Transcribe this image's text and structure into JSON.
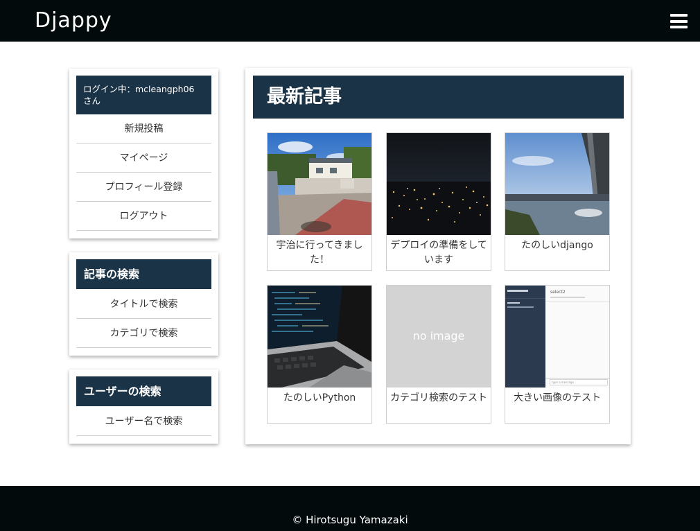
{
  "header": {
    "brand": "Djappy",
    "menu_icon": "hamburger-menu-icon"
  },
  "sidebar": {
    "login_status": "ログイン中：mcleangph06 さん",
    "user_menu": [
      {
        "label": "新規投稿"
      },
      {
        "label": "マイページ"
      },
      {
        "label": "プロフィール登録"
      },
      {
        "label": "ログアウト"
      }
    ],
    "article_search": {
      "heading": "記事の検索",
      "items": [
        {
          "label": "タイトルで検索"
        },
        {
          "label": "カテゴリで検索"
        }
      ]
    },
    "user_search": {
      "heading": "ユーザーの検索",
      "items": [
        {
          "label": "ユーザー名で検索"
        }
      ]
    }
  },
  "main": {
    "heading": "最新記事",
    "articles": [
      {
        "title": "宇治に行ってきました！",
        "image": "photo-street-building"
      },
      {
        "title": "デプロイの準備をしています",
        "image": "photo-night-city"
      },
      {
        "title": "たのしいdjango",
        "image": "photo-river-bridge"
      },
      {
        "title": "たのしいPython",
        "image": "photo-laptop-code"
      },
      {
        "title": "カテゴリ検索のテスト",
        "image": "no-image",
        "placeholder": "no image"
      },
      {
        "title": "大きい画像のテスト",
        "image": "screenshot-chat-app",
        "screenshot_title": "select2",
        "screenshot_input": "type a message"
      }
    ]
  },
  "footer": {
    "copyright": "© Hirotsugu Yamazaki"
  },
  "colors": {
    "header_bg": "#020a0c",
    "accent_navy": "#1b3347",
    "placeholder_gray": "#d3d3d3"
  }
}
